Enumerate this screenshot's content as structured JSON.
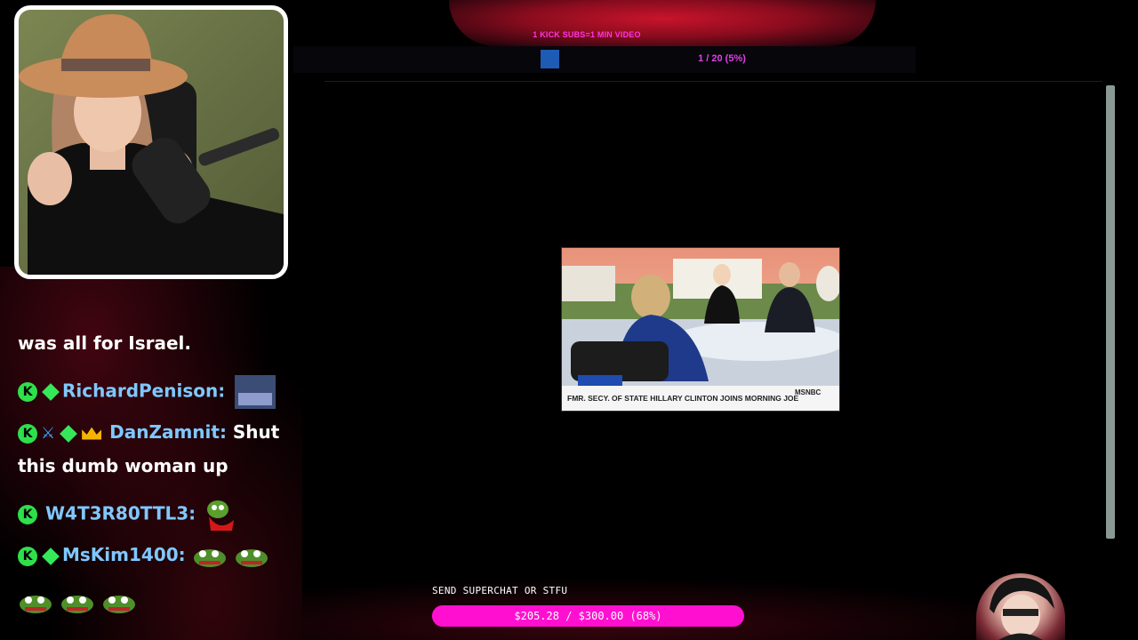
{
  "banner": {
    "text": "1 KICK SUBS=1 MIN VIDEO"
  },
  "queue": {
    "counter": "1 / 20 (5%)"
  },
  "video": {
    "lower_third": "FMR. SECY. OF STATE HILLARY CLINTON JOINS MORNING JOE",
    "network": "MSNBC"
  },
  "chat": {
    "continued_text": "was all for Israel.",
    "messages": [
      {
        "username": "RichardPenison:",
        "text": ""
      },
      {
        "username": "DanZamnit:",
        "text": "Shut",
        "text_wrap": "this dumb woman up"
      },
      {
        "username": "W4T3R80TTL3:",
        "text": ""
      },
      {
        "username": "MsKim1400:",
        "text": ""
      }
    ]
  },
  "goal": {
    "title": "SEND SUPERCHAT OR STFU",
    "amount_text": "$205.28 / $300.00 (68%)",
    "current": 205.28,
    "target": 300.0,
    "percent": 68,
    "color": "#ff10d0"
  },
  "colors": {
    "username": "#7fc8ff",
    "badge_green": "#2ee04a",
    "banner_red": "#c8142c",
    "banner_text": "#ff35e0"
  }
}
